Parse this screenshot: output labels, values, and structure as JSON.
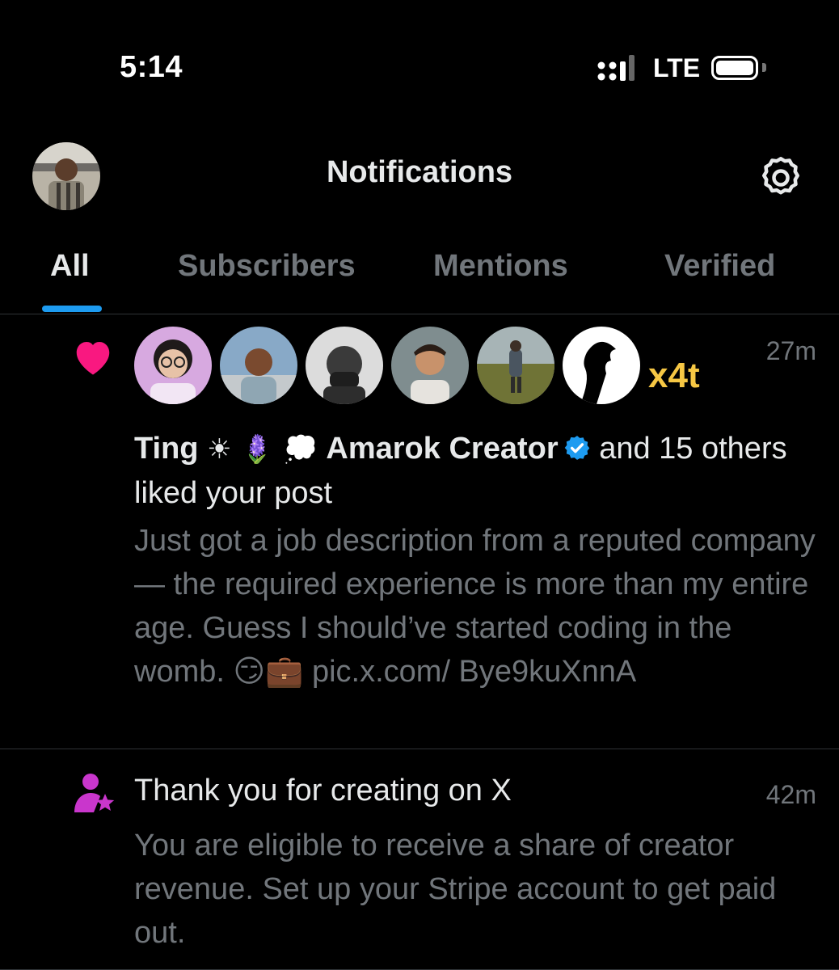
{
  "status_bar": {
    "time": "5:14",
    "network": "LTE"
  },
  "header": {
    "title": "Notifications",
    "settings_icon": "gear-icon"
  },
  "tabs": [
    {
      "label": "All",
      "active": true
    },
    {
      "label": "Subscribers",
      "active": false
    },
    {
      "label": "Mentions",
      "active": false
    },
    {
      "label": "Verified",
      "active": false
    }
  ],
  "notifications": {
    "like": {
      "icon": "heart-icon",
      "icon_color": "#f91880",
      "time": "27m",
      "more_avatars_label": "x4t",
      "user1": "Ting",
      "user1_emojis": "☀ 🪻 💭",
      "user2": "Amarok Creator",
      "and_others": "and 15",
      "action": "others liked your post",
      "post_text": "Just got a job description from a reputed company — the required experience is more than my entire age. Guess I should’ve started coding in the womb. 😏💼 pic.x.com/ Bye9kuXnnA"
    },
    "creator": {
      "icon": "creator-star-icon",
      "icon_color": "#c936cc",
      "time": "42m",
      "title": "Thank you for creating on X",
      "body": "You are eligible to receive a share of creator revenue. Set up your Stripe account to get paid out."
    }
  },
  "colors": {
    "background": "#000000",
    "accent": "#1d9bf0",
    "muted_text": "#71767b",
    "primary_text": "#e7e9ea",
    "verified": "#1d9bf0"
  }
}
